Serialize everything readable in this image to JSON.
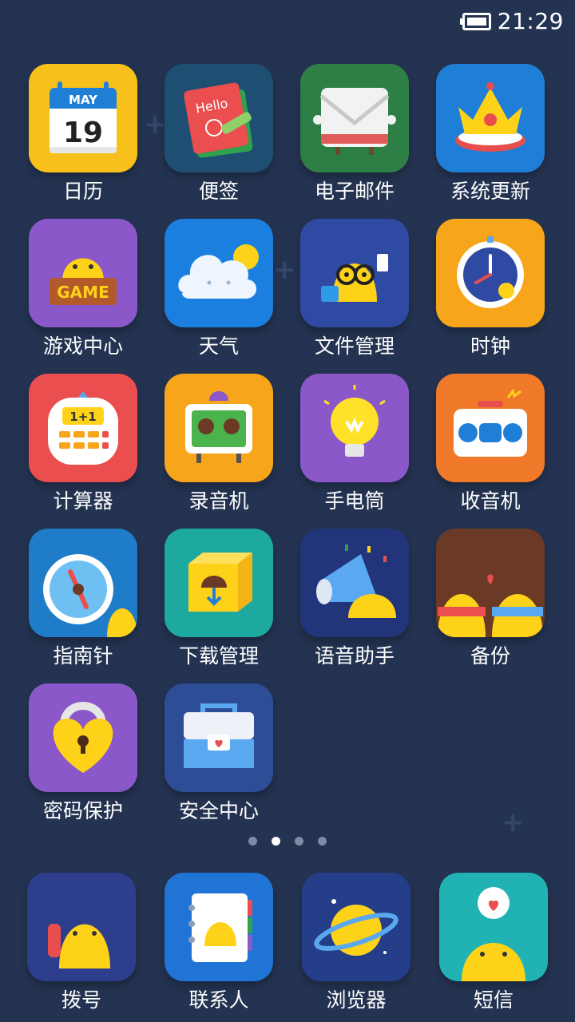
{
  "status_bar": {
    "time": "21:29",
    "battery_icon": "battery-icon"
  },
  "apps": [
    {
      "label": "日历",
      "icon": "calendar-icon",
      "calendar": {
        "month": "MAY",
        "day": "19"
      }
    },
    {
      "label": "便签",
      "icon": "notes-icon",
      "note_text": "Hello"
    },
    {
      "label": "电子邮件",
      "icon": "email-icon"
    },
    {
      "label": "系统更新",
      "icon": "crown-update-icon"
    },
    {
      "label": "游戏中心",
      "icon": "game-center-icon",
      "sign": "GAME"
    },
    {
      "label": "天气",
      "icon": "weather-cloud-icon"
    },
    {
      "label": "文件管理",
      "icon": "file-manager-icon"
    },
    {
      "label": "时钟",
      "icon": "clock-icon"
    },
    {
      "label": "计算器",
      "icon": "calculator-icon",
      "display": "1+1"
    },
    {
      "label": "录音机",
      "icon": "recorder-icon"
    },
    {
      "label": "手电筒",
      "icon": "flashlight-bulb-icon"
    },
    {
      "label": "收音机",
      "icon": "radio-icon"
    },
    {
      "label": "指南针",
      "icon": "compass-icon"
    },
    {
      "label": "下载管理",
      "icon": "download-box-icon"
    },
    {
      "label": "语音助手",
      "icon": "megaphone-icon"
    },
    {
      "label": "备份",
      "icon": "backup-friends-icon"
    },
    {
      "label": "密码保护",
      "icon": "heart-lock-icon"
    },
    {
      "label": "安全中心",
      "icon": "security-box-icon"
    }
  ],
  "page_indicator": {
    "count": 4,
    "active_index": 1
  },
  "dock": [
    {
      "label": "拨号",
      "icon": "phone-dialer-icon"
    },
    {
      "label": "联系人",
      "icon": "contacts-book-icon"
    },
    {
      "label": "浏览器",
      "icon": "planet-browser-icon"
    },
    {
      "label": "短信",
      "icon": "message-heart-icon"
    }
  ],
  "colors": {
    "background": "#243351",
    "tiles": [
      "#f8c01a",
      "#1e4f73",
      "#2e7f45",
      "#1f7fd6",
      "#8a58c8",
      "#1b7fe0",
      "#2f4aa2",
      "#f7a51a",
      "#ea4e4e",
      "#f7a51a",
      "#8a58c8",
      "#f07a2a",
      "#1e7cc8",
      "#1ea9a0",
      "#23357a",
      "#6b3a26",
      "#8a58c8",
      "#2d4d96",
      "#2d3f8c",
      "#1f74d6",
      "#243e8a",
      "#21b3b3"
    ]
  }
}
